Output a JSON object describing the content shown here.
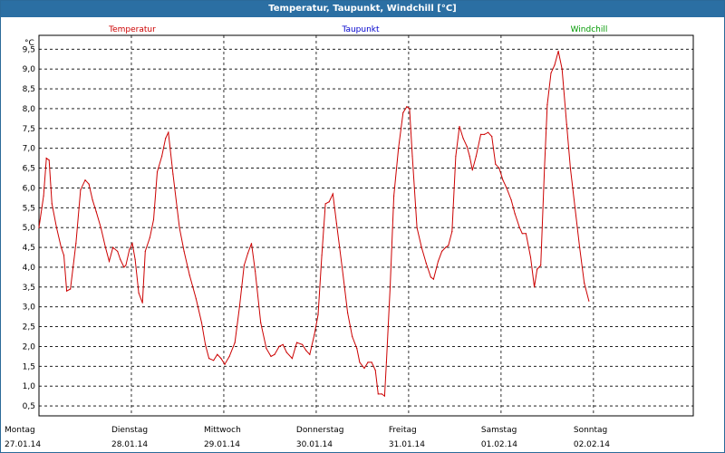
{
  "window": {
    "title": "Temperatur, Taupunkt, Windchill [°C]"
  },
  "colors": {
    "temperatur": "#cc0000",
    "taupunkt": "#0000cc",
    "windchill": "#009900",
    "frame": "#2b6fa3"
  },
  "chart_data": {
    "type": "line",
    "title": "Temperatur, Taupunkt, Windchill [°C]",
    "ylabel": "°C",
    "ylim": [
      0.25,
      9.85
    ],
    "yticks": [
      "0,5",
      "1,0",
      "1,5",
      "2,0",
      "2,5",
      "3,0",
      "3,5",
      "4,0",
      "4,5",
      "5,0",
      "5,5",
      "6,0",
      "6,5",
      "7,0",
      "7,5",
      "8,0",
      "8,5",
      "9,0",
      "9,5"
    ],
    "xlim": [
      0,
      7.08
    ],
    "grid": true,
    "x_ticks": [
      {
        "day": "Montag",
        "date": "27.01.14"
      },
      {
        "day": "Dienstag",
        "date": "28.01.14"
      },
      {
        "day": "Mittwoch",
        "date": "29.01.14"
      },
      {
        "day": "Donnerstag",
        "date": "30.01.14"
      },
      {
        "day": "Freitag",
        "date": "31.01.14"
      },
      {
        "day": "Samstag",
        "date": "01.02.14"
      },
      {
        "day": "Sonntag",
        "date": "02.02.14"
      }
    ],
    "series": [
      {
        "name": "Temperatur",
        "color": "#cc0000",
        "points": [
          [
            0.0,
            5.0
          ],
          [
            0.05,
            5.8
          ],
          [
            0.08,
            6.75
          ],
          [
            0.11,
            6.7
          ],
          [
            0.14,
            5.6
          ],
          [
            0.19,
            5.0
          ],
          [
            0.24,
            4.5
          ],
          [
            0.27,
            4.3
          ],
          [
            0.3,
            3.4
          ],
          [
            0.34,
            3.45
          ],
          [
            0.4,
            4.6
          ],
          [
            0.45,
            5.95
          ],
          [
            0.5,
            6.2
          ],
          [
            0.54,
            6.1
          ],
          [
            0.58,
            5.7
          ],
          [
            0.62,
            5.4
          ],
          [
            0.67,
            5.0
          ],
          [
            0.72,
            4.5
          ],
          [
            0.76,
            4.15
          ],
          [
            0.8,
            4.5
          ],
          [
            0.85,
            4.4
          ],
          [
            0.88,
            4.2
          ],
          [
            0.92,
            4.0
          ],
          [
            0.94,
            4.05
          ],
          [
            0.98,
            4.45
          ],
          [
            1.01,
            4.6
          ],
          [
            1.04,
            4.2
          ],
          [
            1.08,
            3.35
          ],
          [
            1.12,
            3.1
          ],
          [
            1.15,
            4.4
          ],
          [
            1.2,
            4.75
          ],
          [
            1.24,
            5.2
          ],
          [
            1.28,
            6.4
          ],
          [
            1.33,
            6.8
          ],
          [
            1.37,
            7.25
          ],
          [
            1.4,
            7.4
          ],
          [
            1.45,
            6.35
          ],
          [
            1.52,
            5.0
          ],
          [
            1.57,
            4.4
          ],
          [
            1.63,
            3.8
          ],
          [
            1.7,
            3.2
          ],
          [
            1.76,
            2.6
          ],
          [
            1.8,
            2.05
          ],
          [
            1.84,
            1.7
          ],
          [
            1.89,
            1.65
          ],
          [
            1.93,
            1.8
          ],
          [
            1.97,
            1.7
          ],
          [
            2.01,
            1.55
          ],
          [
            2.06,
            1.75
          ],
          [
            2.12,
            2.1
          ],
          [
            2.17,
            3.0
          ],
          [
            2.22,
            4.05
          ],
          [
            2.26,
            4.35
          ],
          [
            2.3,
            4.6
          ],
          [
            2.34,
            3.9
          ],
          [
            2.4,
            2.6
          ],
          [
            2.46,
            1.95
          ],
          [
            2.51,
            1.75
          ],
          [
            2.55,
            1.8
          ],
          [
            2.6,
            2.0
          ],
          [
            2.64,
            2.05
          ],
          [
            2.68,
            1.85
          ],
          [
            2.74,
            1.7
          ],
          [
            2.79,
            2.1
          ],
          [
            2.85,
            2.05
          ],
          [
            2.89,
            1.9
          ],
          [
            2.93,
            1.8
          ],
          [
            2.98,
            2.3
          ],
          [
            3.02,
            2.8
          ],
          [
            3.06,
            4.3
          ],
          [
            3.1,
            5.6
          ],
          [
            3.14,
            5.65
          ],
          [
            3.18,
            5.85
          ],
          [
            3.22,
            5.1
          ],
          [
            3.28,
            4.0
          ],
          [
            3.34,
            2.85
          ],
          [
            3.39,
            2.25
          ],
          [
            3.44,
            1.95
          ],
          [
            3.47,
            1.6
          ],
          [
            3.52,
            1.45
          ],
          [
            3.56,
            1.6
          ],
          [
            3.6,
            1.6
          ],
          [
            3.64,
            1.4
          ],
          [
            3.67,
            0.8
          ],
          [
            3.71,
            0.8
          ],
          [
            3.74,
            0.75
          ],
          [
            3.76,
            1.6
          ],
          [
            3.8,
            3.5
          ],
          [
            3.84,
            5.8
          ],
          [
            3.89,
            7.0
          ],
          [
            3.94,
            7.9
          ],
          [
            3.98,
            8.05
          ],
          [
            4.01,
            8.0
          ],
          [
            4.04,
            6.8
          ],
          [
            4.09,
            5.0
          ],
          [
            4.14,
            4.5
          ],
          [
            4.19,
            4.1
          ],
          [
            4.24,
            3.75
          ],
          [
            4.27,
            3.7
          ],
          [
            4.32,
            4.15
          ],
          [
            4.36,
            4.4
          ],
          [
            4.4,
            4.5
          ],
          [
            4.43,
            4.55
          ],
          [
            4.47,
            4.9
          ],
          [
            4.51,
            6.8
          ],
          [
            4.55,
            7.55
          ],
          [
            4.59,
            7.25
          ],
          [
            4.63,
            7.05
          ],
          [
            4.66,
            6.8
          ],
          [
            4.69,
            6.45
          ],
          [
            4.73,
            6.8
          ],
          [
            4.78,
            7.35
          ],
          [
            4.82,
            7.35
          ],
          [
            4.86,
            7.4
          ],
          [
            4.9,
            7.3
          ],
          [
            4.94,
            6.6
          ],
          [
            4.98,
            6.5
          ],
          [
            5.02,
            6.2
          ],
          [
            5.06,
            6.0
          ],
          [
            5.11,
            5.7
          ],
          [
            5.15,
            5.35
          ],
          [
            5.2,
            5.0
          ],
          [
            5.23,
            4.85
          ],
          [
            5.27,
            4.85
          ],
          [
            5.32,
            4.25
          ],
          [
            5.36,
            3.5
          ],
          [
            5.39,
            3.95
          ],
          [
            5.43,
            4.05
          ],
          [
            5.47,
            6.5
          ],
          [
            5.5,
            8.1
          ],
          [
            5.54,
            8.9
          ],
          [
            5.58,
            9.1
          ],
          [
            5.62,
            9.45
          ],
          [
            5.66,
            9.0
          ],
          [
            5.71,
            7.6
          ],
          [
            5.75,
            6.5
          ],
          [
            5.8,
            5.5
          ],
          [
            5.85,
            4.5
          ],
          [
            5.9,
            3.6
          ],
          [
            5.95,
            3.15
          ]
        ]
      },
      {
        "name": "Taupunkt",
        "color": "#0000cc",
        "points": []
      },
      {
        "name": "Windchill",
        "color": "#009900",
        "points": []
      }
    ]
  }
}
